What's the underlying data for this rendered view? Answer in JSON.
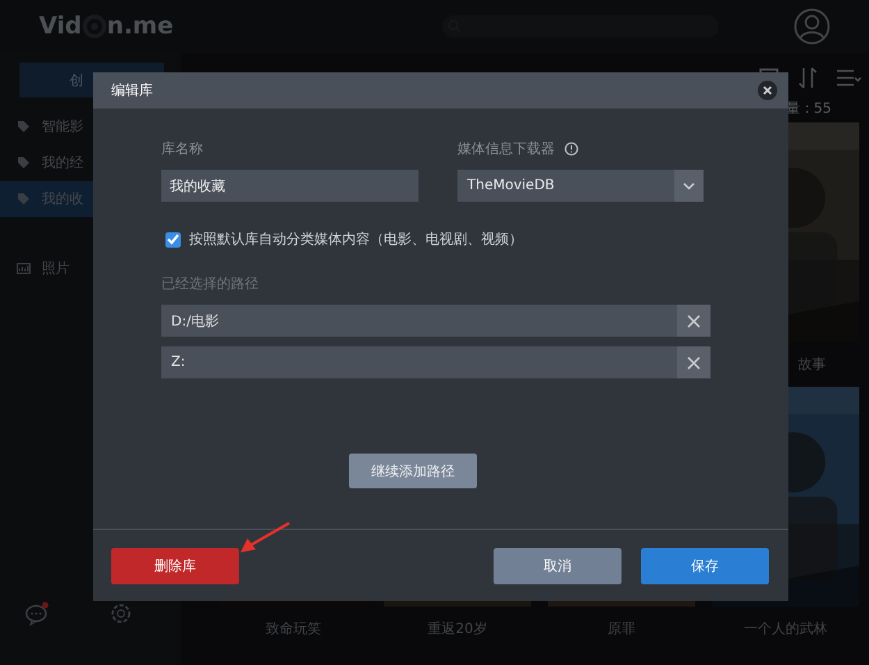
{
  "header": {
    "logo_left": "Vid",
    "logo_right": "n.me"
  },
  "sidebar": {
    "create_button": "创",
    "items": [
      {
        "label": "智能影",
        "kind": "tag",
        "selected": false
      },
      {
        "label": "我的经",
        "kind": "tag",
        "selected": false
      },
      {
        "label": "我的收",
        "kind": "tag",
        "selected": true
      },
      {
        "label": "照片",
        "selected": false
      }
    ]
  },
  "content": {
    "count": "量：55",
    "rows": [
      [
        "",
        "",
        "",
        {
          "title": "故事"
        }
      ],
      [
        {
          "title": "致命玩笑"
        },
        {
          "title": "重返20岁"
        },
        {
          "title": "原罪"
        },
        {
          "title": "一个人的武林"
        }
      ]
    ]
  },
  "dialog": {
    "title": "编辑库",
    "name_label": "库名称",
    "name_value": "我的收藏",
    "downloader_label": "媒体信息下载器",
    "downloader_value": "TheMovieDB",
    "auto_classify": {
      "label": "按照默认库自动分类媒体内容（电影、电视剧、视频）",
      "checked": true
    },
    "paths_label": "已经选择的路径",
    "paths": [
      "D:/电影",
      "Z:"
    ],
    "add_path_button": "继续添加路径",
    "delete_button": "删除库",
    "cancel_button": "取消",
    "save_button": "保存"
  }
}
